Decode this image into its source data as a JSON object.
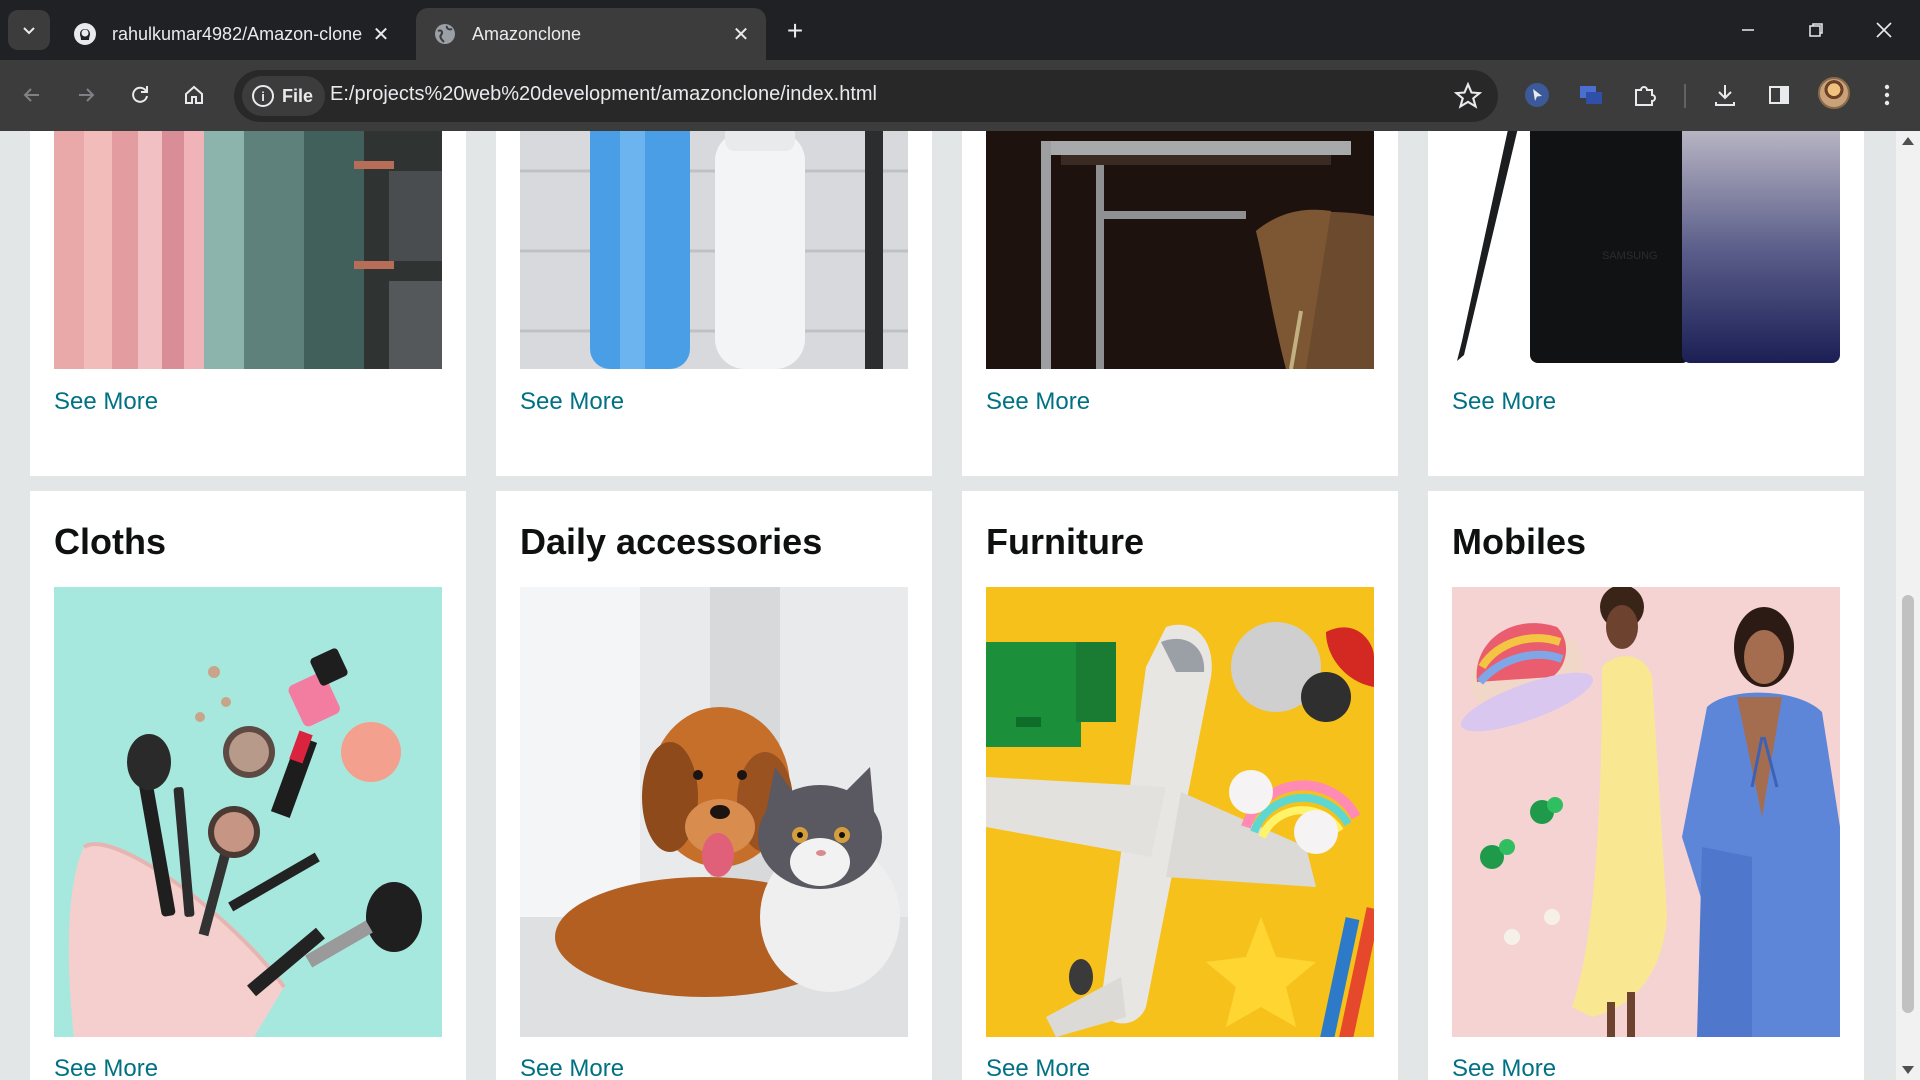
{
  "browser": {
    "tabs": [
      {
        "title": "rahulkumar4982/Amazon-clone",
        "icon": "github-icon",
        "active": false
      },
      {
        "title": "Amazonclone",
        "icon": "globe-icon",
        "active": true
      }
    ],
    "address": {
      "chip_label": "File",
      "url": "E:/projects%20web%20development/amazonclone/index.html"
    }
  },
  "page": {
    "accent_link_color": "#007185",
    "top_row": [
      {
        "see_more": "See More",
        "image": "curtains-photo"
      },
      {
        "see_more": "See More",
        "image": "toiletries-photo"
      },
      {
        "see_more": "See More",
        "image": "desk-chair-photo"
      },
      {
        "see_more": "See More",
        "image": "samsung-phone-photo"
      }
    ],
    "bottom_row": [
      {
        "title": "Cloths",
        "see_more": "See More",
        "image": "makeup-photo"
      },
      {
        "title": "Daily accessories",
        "see_more": "See More",
        "image": "dog-cat-photo"
      },
      {
        "title": "Furniture",
        "see_more": "See More",
        "image": "toy-plane-photo"
      },
      {
        "title": "Mobiles",
        "see_more": "See More",
        "image": "fashion-photo"
      }
    ]
  }
}
